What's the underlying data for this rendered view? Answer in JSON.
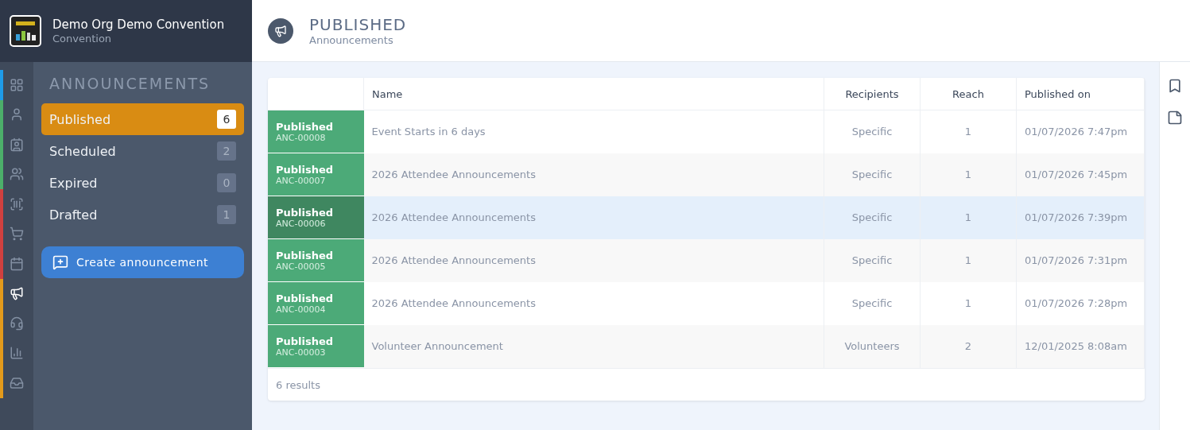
{
  "org": {
    "name": "Demo Org Demo Convention",
    "subtitle": "Convention"
  },
  "rail": [
    {
      "selected": false,
      "color": "#1e9be9"
    },
    {
      "selected": false,
      "color": "#4caf6a"
    },
    {
      "selected": false,
      "color": "#4caf6a"
    },
    {
      "selected": false,
      "color": "#4caf6a"
    },
    {
      "selected": false,
      "color": "#d0403f"
    },
    {
      "selected": false,
      "color": "#d0403f"
    },
    {
      "selected": false,
      "color": "#d0403f"
    },
    {
      "selected": true,
      "color": "#e39a1b"
    },
    {
      "selected": false,
      "color": "#e39a1b"
    },
    {
      "selected": false,
      "color": "#e39a1b"
    },
    {
      "selected": false,
      "color": "#e39a1b"
    }
  ],
  "sidebar": {
    "title": "ANNOUNCEMENTS",
    "items": [
      {
        "label": "Published",
        "count": "6",
        "selected": true
      },
      {
        "label": "Scheduled",
        "count": "2",
        "selected": false
      },
      {
        "label": "Expired",
        "count": "0",
        "selected": false
      },
      {
        "label": "Drafted",
        "count": "1",
        "selected": false
      }
    ],
    "button": "Create announcement"
  },
  "header": {
    "title": "PUBLISHED",
    "subtitle": "Announcements"
  },
  "table": {
    "columns": [
      "Name",
      "Recipients",
      "Reach",
      "Published on"
    ],
    "rows": [
      {
        "status": "Published",
        "id": "ANC-00008",
        "name": "Event Starts in 6 days",
        "recipients": "Specific",
        "reach": "1",
        "published_on": "01/07/2026 7:47pm",
        "selected": false
      },
      {
        "status": "Published",
        "id": "ANC-00007",
        "name": "2026 Attendee Announcements",
        "recipients": "Specific",
        "reach": "1",
        "published_on": "01/07/2026 7:45pm",
        "selected": false
      },
      {
        "status": "Published",
        "id": "ANC-00006",
        "name": "2026 Attendee Announcements",
        "recipients": "Specific",
        "reach": "1",
        "published_on": "01/07/2026 7:39pm",
        "selected": true
      },
      {
        "status": "Published",
        "id": "ANC-00005",
        "name": "2026 Attendee Announcements",
        "recipients": "Specific",
        "reach": "1",
        "published_on": "01/07/2026 7:31pm",
        "selected": false
      },
      {
        "status": "Published",
        "id": "ANC-00004",
        "name": "2026 Attendee Announcements",
        "recipients": "Specific",
        "reach": "1",
        "published_on": "01/07/2026 7:28pm",
        "selected": false
      },
      {
        "status": "Published",
        "id": "ANC-00003",
        "name": "Volunteer Announcement",
        "recipients": "Volunteers",
        "reach": "2",
        "published_on": "12/01/2025 8:08am",
        "selected": false
      }
    ],
    "footer": "6 results"
  }
}
